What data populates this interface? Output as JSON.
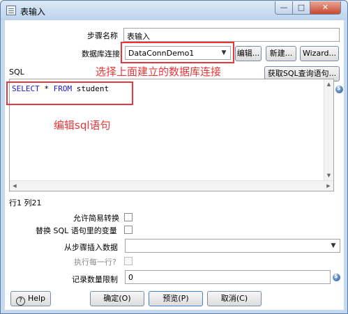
{
  "window": {
    "title": "表输入",
    "minimize": "—",
    "maximize": "□",
    "close": "✕"
  },
  "form": {
    "step_name_label": "步骤名称",
    "step_name_value": "表输入",
    "db_conn_label": "数据库连接",
    "db_conn_value": "DataConnDemo1",
    "edit_button": "编辑...",
    "new_button": "新建...",
    "wizard_button": "Wizard...",
    "sql_label": "SQL",
    "get_sql_button": "获取SQL查询语句...",
    "sql_keyword_select": "SELECT",
    "sql_star": " * ",
    "sql_keyword_from": "FROM",
    "sql_table": " student",
    "cursor_position": "行1 列21",
    "lazy_conversion_label": "允许简易转换",
    "replace_vars_label": "替换 SQL 语句里的变量",
    "insert_from_step_label": "从步骤插入数据",
    "insert_from_step_value": "",
    "execute_each_row_label": "执行每一行?",
    "limit_label": "记录数量限制",
    "limit_value": "0"
  },
  "buttons": {
    "help": "Help",
    "ok": "确定(O)",
    "preview": "预览(P)",
    "cancel": "取消(C)"
  },
  "annotations": {
    "select_db": "选择上面建立的数据库连接",
    "edit_sql": "编辑sql语句"
  },
  "icons": {
    "title": "table-input-icon",
    "variable": "variable-dollar-icon",
    "help": "question-icon",
    "dropdown": "chevron-down-icon"
  },
  "colors": {
    "annotation": "#e8363a",
    "sql_keyword": "#1a1ad1",
    "title_bar": "#c5d9ef"
  }
}
